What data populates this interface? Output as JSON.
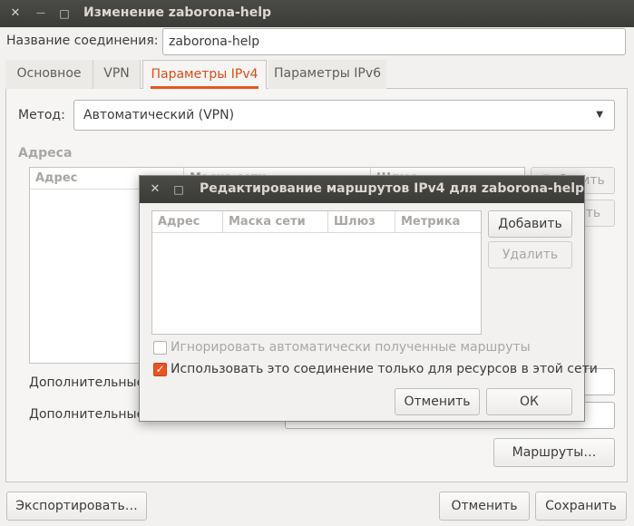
{
  "window": {
    "title": "Изменение zaborona-help",
    "close_glyph": "✕",
    "minimize_glyph": "—",
    "maximize_glyph": "□"
  },
  "connection": {
    "name_label": "Название соединения:",
    "name_value": "zaborona-help"
  },
  "tabs": [
    {
      "label": "Основное",
      "active": false
    },
    {
      "label": "VPN",
      "active": false
    },
    {
      "label": "Параметры IPv4",
      "active": true
    },
    {
      "label": "Параметры IPv6",
      "active": false
    }
  ],
  "ipv4": {
    "method_label": "Метод:",
    "method_value": "Автоматический (VPN)",
    "addresses_heading": "Адреса",
    "address_columns": [
      "Адрес",
      "Маска сети",
      "Шлюз"
    ],
    "add_button": "Добавить",
    "delete_button": "Удалить",
    "extra_label_1": "Дополнительные",
    "extra_label_2": "Дополнительные",
    "routes_button": "Маршруты…"
  },
  "routes_dialog": {
    "title": "Редактирование маршрутов IPv4 для zaborona-help",
    "columns": [
      "Адрес",
      "Маска сети",
      "Шлюз",
      "Метрика"
    ],
    "add_button": "Добавить",
    "delete_button": "Удалить",
    "ignore_auto_routes": {
      "label": "Игнорировать автоматически полученные маршруты",
      "checked": false
    },
    "only_local_resources": {
      "label": "Использовать это соединение только для ресурсов в этой сети",
      "checked": true
    },
    "cancel_button": "Отменить",
    "ok_button": "ОК"
  },
  "footer": {
    "export_button": "Экспортировать…",
    "cancel_button": "Отменить",
    "save_button": "Сохранить"
  },
  "colors": {
    "accent": "#e95420",
    "titlebar": "#3e3e3b"
  }
}
